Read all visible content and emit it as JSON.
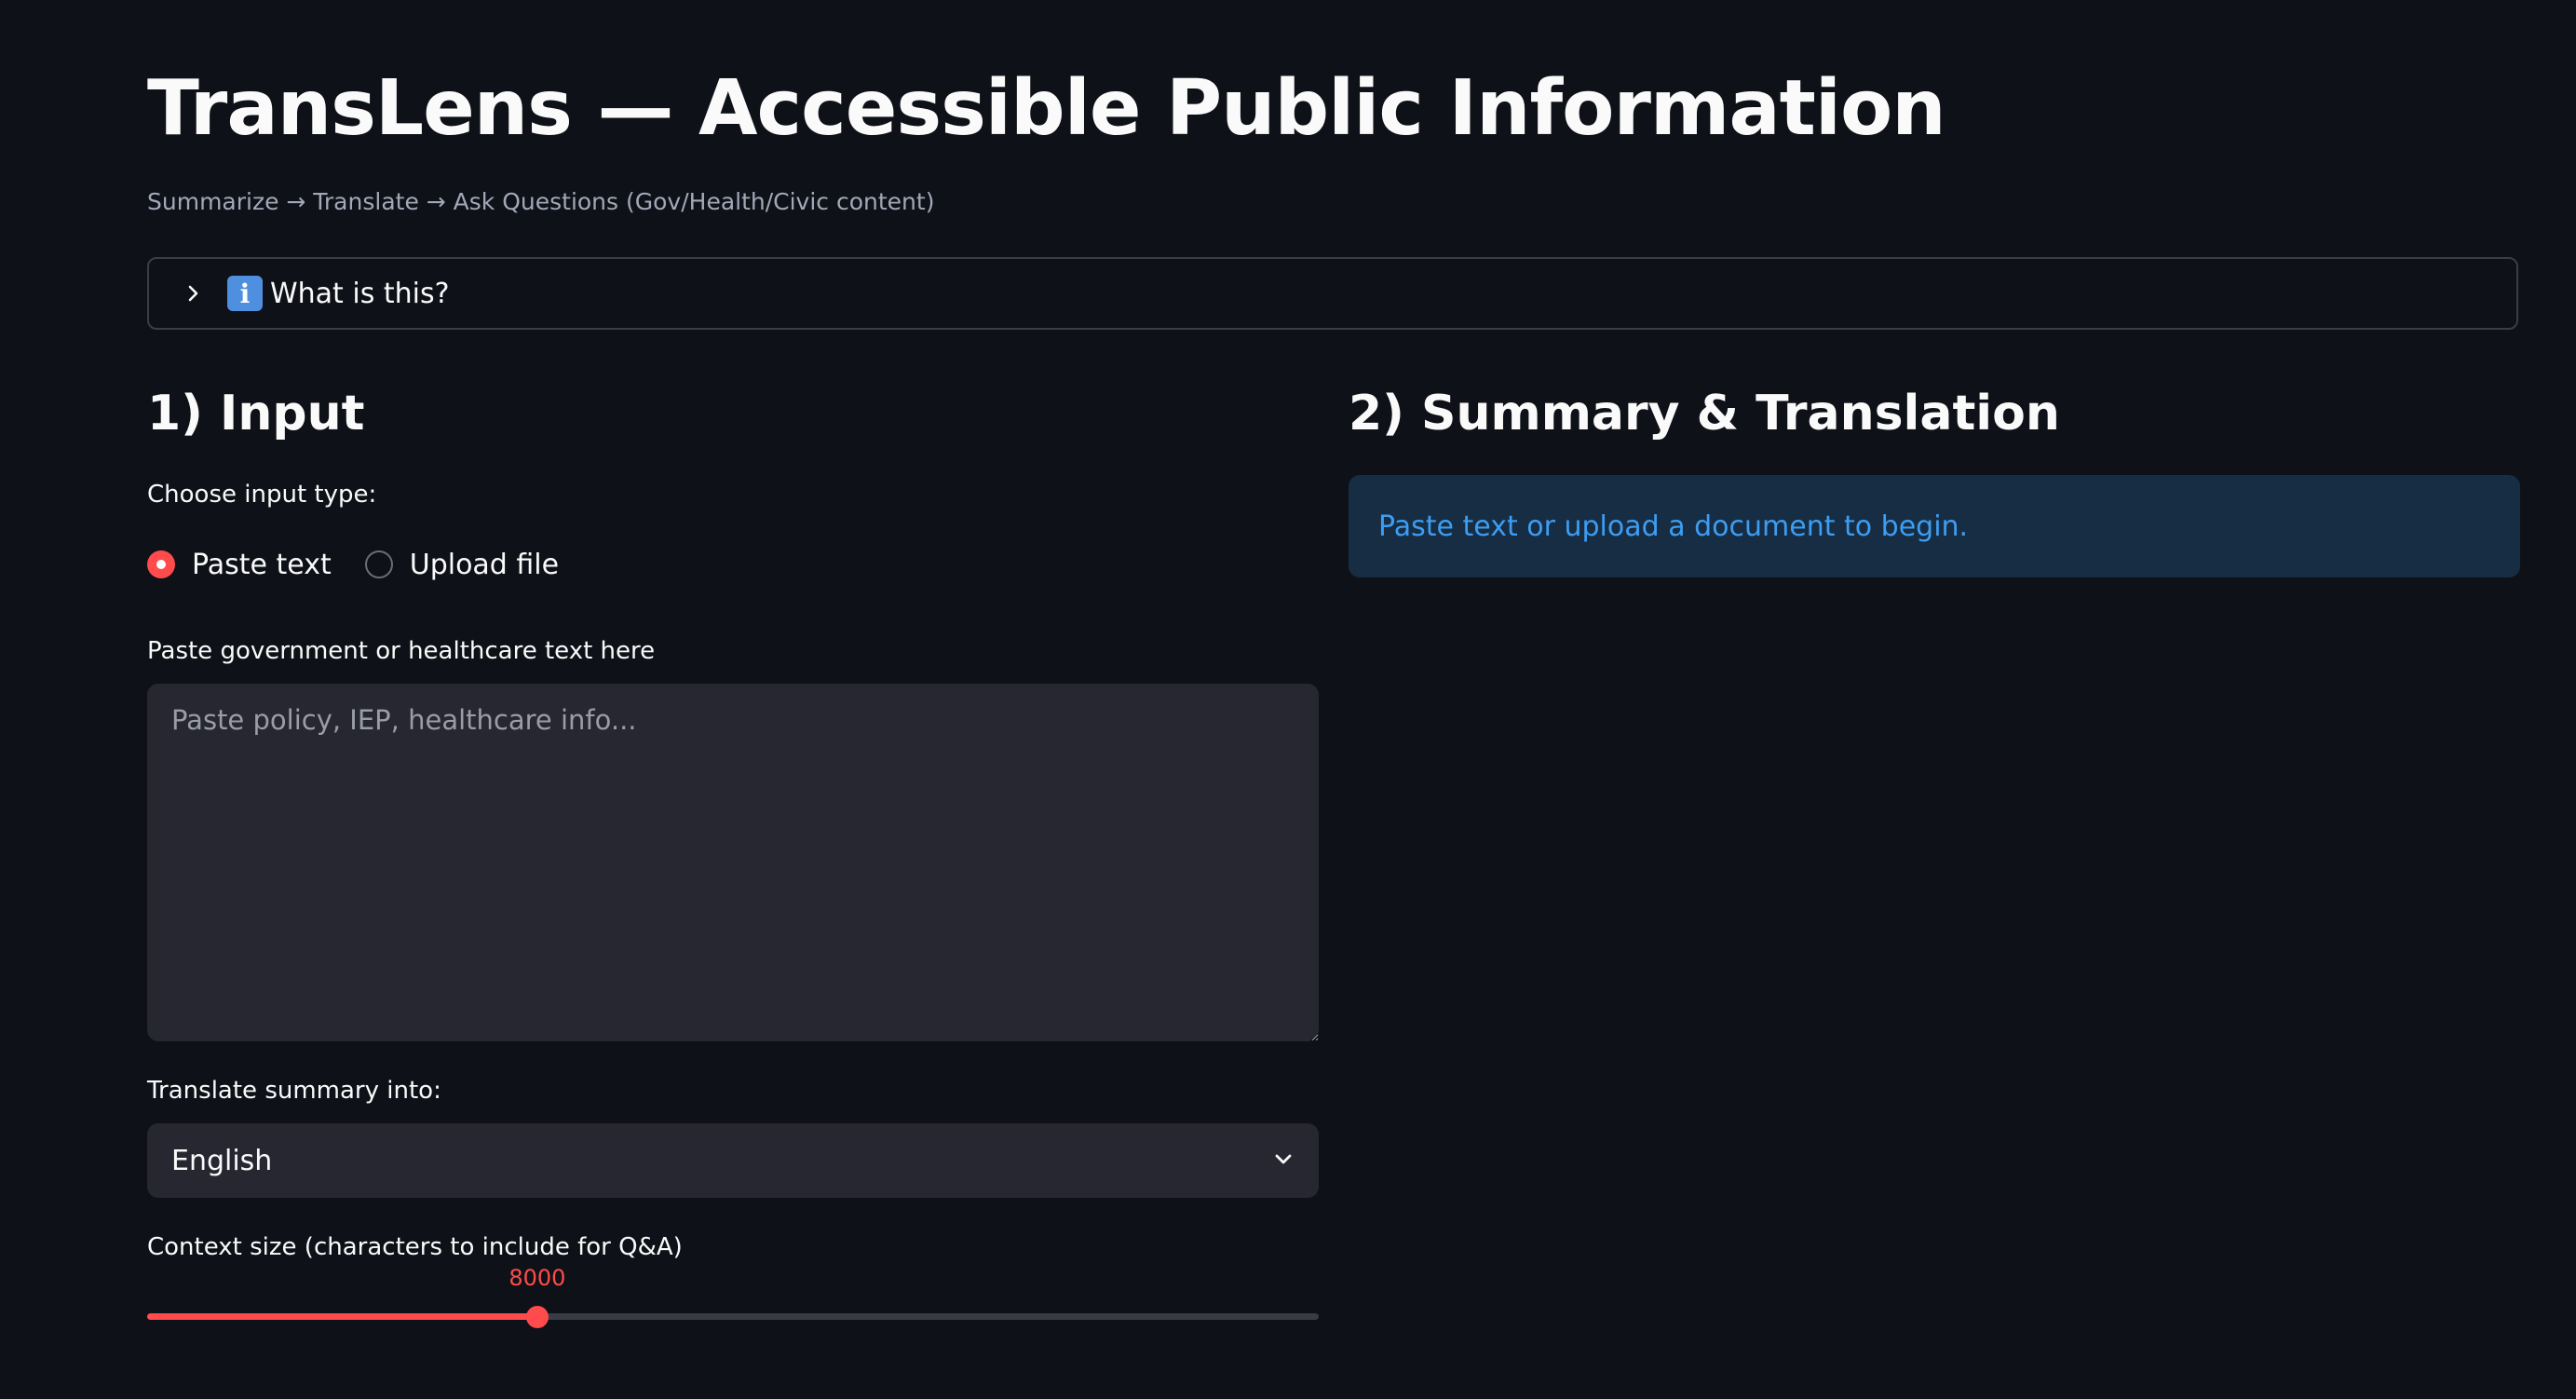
{
  "header": {
    "title": "TransLens — Accessible Public Information",
    "caption": "Summarize → Translate → Ask Questions (Gov/Health/Civic content)"
  },
  "expander": {
    "icon": "info-icon",
    "info_glyph": "i",
    "label": "What is this?"
  },
  "input_section": {
    "title": "1) Input",
    "input_type_label": "Choose input type:",
    "radio_options": [
      "Paste text",
      "Upload file"
    ],
    "selected_option": "Paste text",
    "textarea_label": "Paste government or healthcare text here",
    "textarea_placeholder": "Paste policy, IEP, healthcare info...",
    "textarea_value": "",
    "language_label": "Translate summary into:",
    "language_value": "English",
    "slider_label": "Context size (characters to include for Q&A)",
    "slider_value": "8000",
    "slider_fraction": 0.333
  },
  "output_section": {
    "title": "2) Summary & Translation",
    "info_message": "Paste text or upload a document to begin."
  },
  "colors": {
    "background": "#0e1117",
    "widget_bg": "#262730",
    "accent": "#ff4b4b",
    "info_bg": "#172d43",
    "info_text": "#3d9df3"
  }
}
